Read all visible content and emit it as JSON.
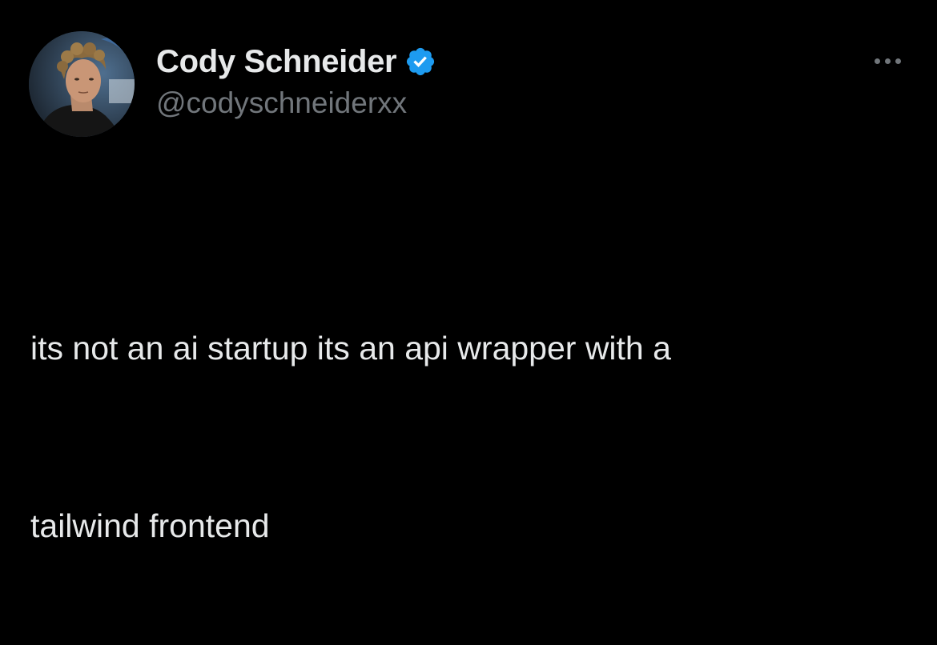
{
  "author": {
    "display_name": "Cody Schneider",
    "handle": "@codyschneiderxx",
    "verified": true,
    "avatar_icon": "profile-photo"
  },
  "post": {
    "text_lines": [
      "its not an ai startup its an api wrapper with a",
      "tailwind frontend"
    ]
  },
  "menu": {
    "icon": "more-horizontal-icon"
  },
  "colors": {
    "background": "#000000",
    "primary_text": "#e7e9ea",
    "secondary_text": "#71767b",
    "verified_blue": "#1d9bf0"
  }
}
